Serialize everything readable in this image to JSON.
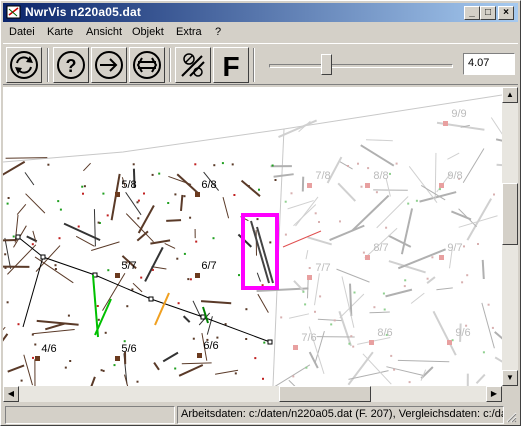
{
  "window": {
    "title": "NwrVis n220a05.dat",
    "minimize_glyph": "_",
    "maximize_glyph": "□",
    "close_glyph": "×"
  },
  "menu": [
    {
      "label": "Datei"
    },
    {
      "label": "Karte"
    },
    {
      "label": "Ansicht"
    },
    {
      "label": "Objekt"
    },
    {
      "label": "Extra"
    },
    {
      "label": "?"
    }
  ],
  "toolbar": {
    "buttons": [
      {
        "icon": "refresh-icon"
      },
      {
        "icon": "help-icon"
      },
      {
        "icon": "arrow-right-icon"
      },
      {
        "icon": "double-arrow-icon"
      },
      {
        "icon": "tools-icon"
      },
      {
        "icon": "font-icon",
        "label": "F"
      }
    ],
    "zoom_slider_position": 0.3,
    "zoom_value": "4.07"
  },
  "map": {
    "left_tiles": [
      "5/8",
      "6/8",
      "5/7",
      "6/7",
      "4/6",
      "5/6",
      "6/6"
    ],
    "right_tiles": [
      "9/9",
      "7/8",
      "8/8",
      "9/8",
      "8/7",
      "7/7",
      "9/7",
      "7/6",
      "8/6",
      "9/6"
    ],
    "highlight_color": "#ff00ff",
    "line_color": "#5a3a28"
  },
  "statusbar": {
    "left": "",
    "right": "Arbeitsdaten: c:/daten/n220a05.dat (F. 207), Vergleichsdaten: c:/dat"
  }
}
